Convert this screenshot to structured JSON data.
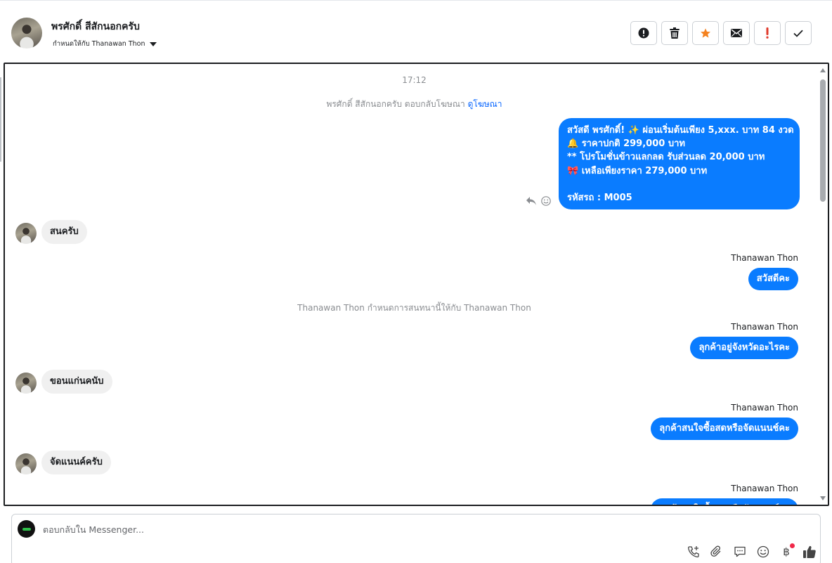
{
  "header": {
    "contact_name": "พรศักดิ์ สีสักนอกครับ",
    "assigned_label": "กำหนดให้กับ Thanawan Thon",
    "actions": [
      {
        "name": "report-spam-button",
        "icon": "exclamation-circle-icon"
      },
      {
        "name": "delete-button",
        "icon": "trash-icon"
      },
      {
        "name": "star-button",
        "icon": "star-icon",
        "color": "#f4821f"
      },
      {
        "name": "mark-unread-button",
        "icon": "envelope-icon"
      },
      {
        "name": "follow-up-button",
        "icon": "exclamation-icon",
        "color": "#e0392b"
      },
      {
        "name": "mark-done-button",
        "icon": "check-icon"
      }
    ]
  },
  "conversation": {
    "timestamp": "17:12",
    "ad_reply_prefix": "พรศักดิ์ สีสักนอกครับ ตอบกลับโฆษณา",
    "ad_reply_link": "ดูโฆษณา",
    "ad_message": {
      "line1": "สวัสดี พรศักดิ์! ✨  ผ่อนเริ่มต้นเพียง 5,xxx. บาท 84 งวด",
      "line2": "🔔 ราคาปกติ 299,000 บาท",
      "line3": "** โปรโมชั่นข้าวแลกลด รับส่วนลด 20,000 บาท",
      "line4": "🎀  เหลือเพียงราคา 279,000 บาท",
      "line5": "รหัสรถ : M005"
    },
    "msg_in_1": "สนครับ",
    "sender_1": "Thanawan Thon",
    "msg_out_1": "สวัสดีคะ",
    "assign_notice": "Thanawan Thon กำหนดการสนทนานี้ให้กับ Thanawan Thon",
    "sender_2": "Thanawan Thon",
    "msg_out_2": "ลุกค้าอยู่จังหวัดอะไรคะ",
    "msg_in_2": "ขอนแก่นคนับ",
    "sender_3": "Thanawan Thon",
    "msg_out_3": "ลุกค้าสนใจซื้อสดหรือจัดแนนช์คะ",
    "msg_in_3": "จัดแนนค์ครับ",
    "sender_4": "Thanawan Thon",
    "msg_out_4": "ลุกค้าสนใจซื้อสดหรือจัดแนนช์คะ"
  },
  "composer": {
    "placeholder": "ตอบกลับใน Messenger...",
    "tools": [
      "call-add-icon",
      "paperclip-icon",
      "chat-bubble-icon",
      "emoji-icon",
      "baht-icon",
      "thumbs-up-icon"
    ],
    "baht_symbol": "฿"
  },
  "colors": {
    "accent_blue": "#0a7cff",
    "incoming_bubble": "#f0f0f0",
    "link_blue": "#0866ff"
  }
}
